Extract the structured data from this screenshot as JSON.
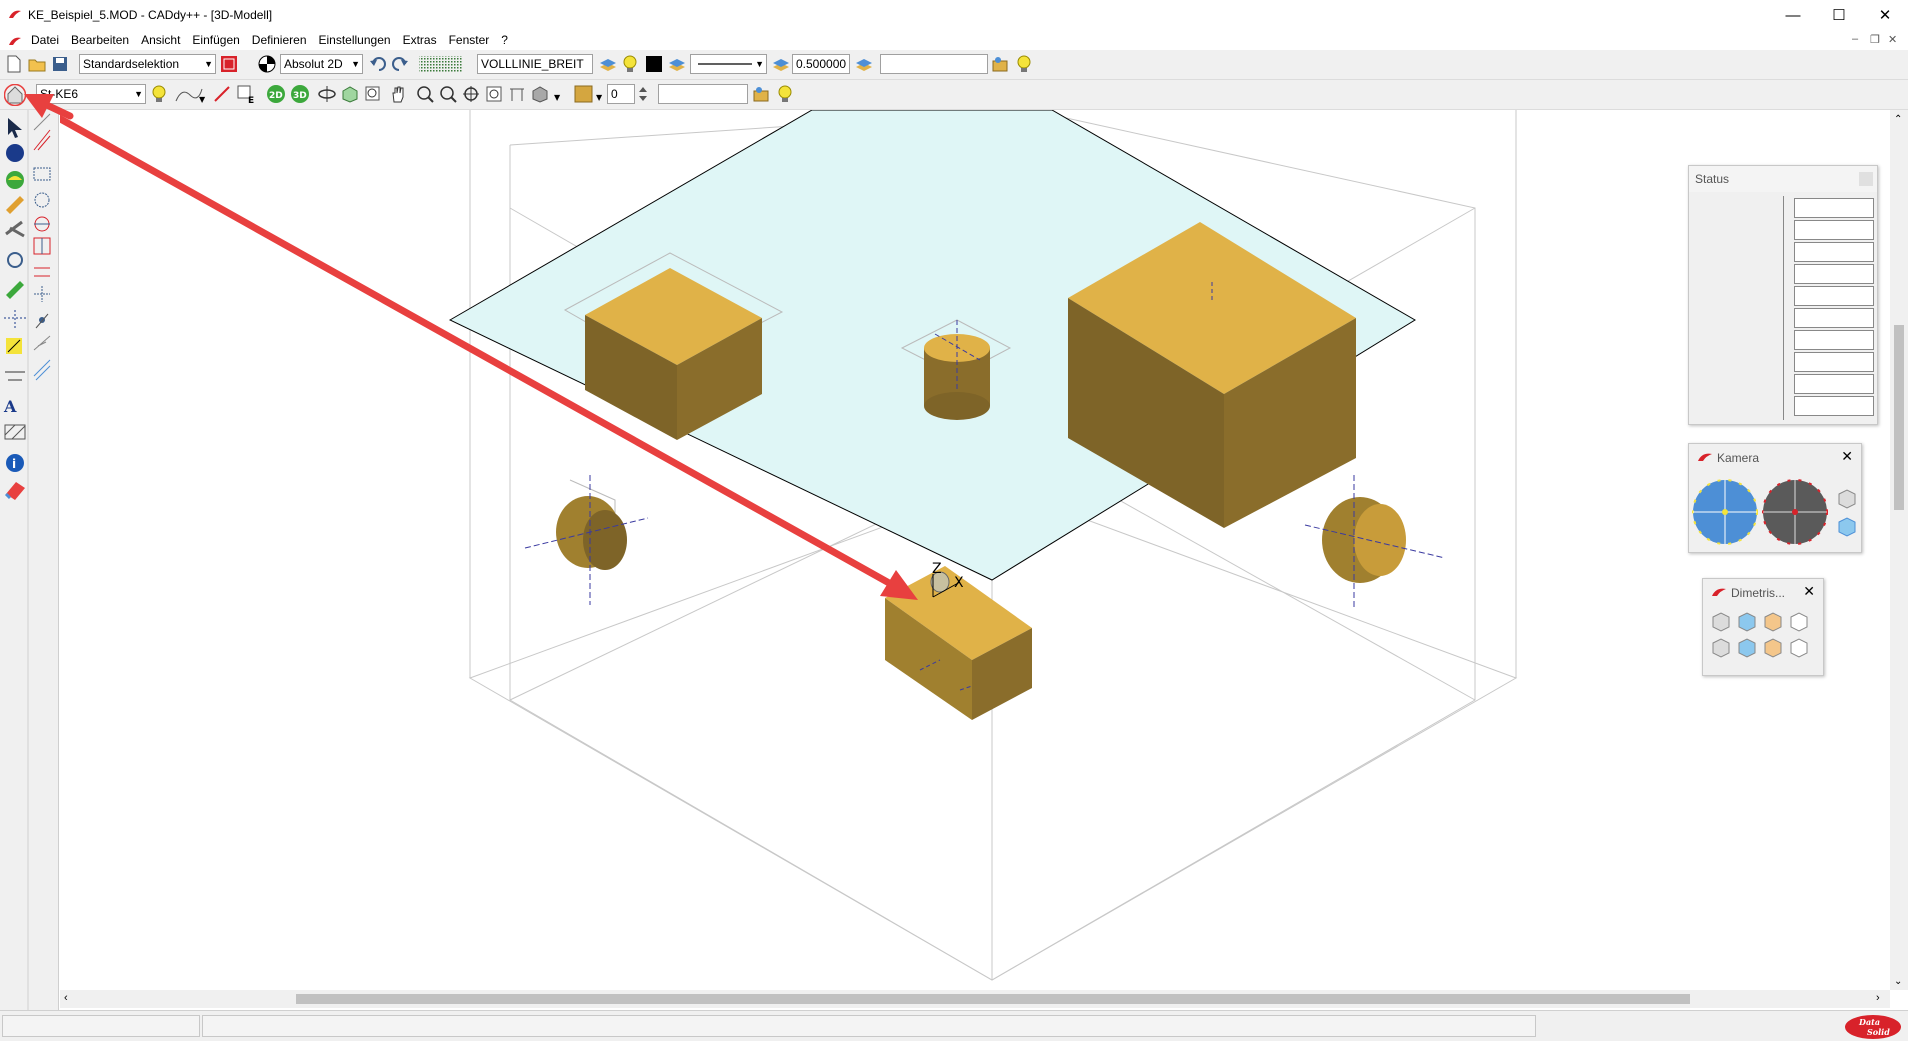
{
  "window": {
    "title": "KE_Beispiel_5.MOD  -  CADdy++ - [3D-Modell]",
    "minimize": "—",
    "maximize": "☐",
    "close": "✕"
  },
  "mdi": {
    "minimize": "–",
    "restore": "❐",
    "close": "✕"
  },
  "menu": [
    "Datei",
    "Bearbeiten",
    "Ansicht",
    "Einfügen",
    "Definieren",
    "Einstellungen",
    "Extras",
    "Fenster",
    "?"
  ],
  "toolbar1": {
    "selection_mode": "Standardselektion",
    "coordinate_mode": "Absolut 2D",
    "linetype_name": "VOLLLINIE_BREIT",
    "line_width": "0.500000",
    "layer_field": ""
  },
  "toolbar2": {
    "group_name": "St-KE6",
    "view_2d": "2D",
    "view_3d": "3D",
    "number_value": "0",
    "text_field": ""
  },
  "panels": {
    "status": {
      "title": "Status"
    },
    "kamera": {
      "title": "Kamera"
    },
    "dimetrisch": {
      "title": "Dimetris..."
    }
  },
  "axis_labels": {
    "z": "Z",
    "x": "X"
  },
  "logo": "Data Solid",
  "colors": {
    "accent_red": "#e8403f",
    "solid_top": "#e0b248",
    "solid_front": "#7e6428",
    "solid_side": "#b0882f",
    "plane_fill": "#dff6f6"
  },
  "icons": [
    "new-file-icon",
    "open-file-icon",
    "save-icon",
    "undo-icon",
    "redo-icon",
    "layer-icon",
    "bulb-icon",
    "home-view-icon",
    "pointer-icon",
    "sphere-icon",
    "info-icon",
    "eraser-icon"
  ]
}
